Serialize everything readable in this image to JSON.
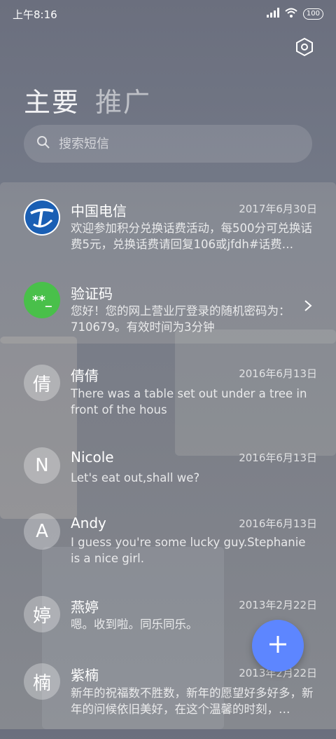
{
  "status_bar": {
    "time": "上午8:16",
    "battery": "100",
    "icons": [
      "signal-icon",
      "wifi-icon",
      "battery-icon"
    ]
  },
  "header": {
    "settings_icon": "gear-icon",
    "tabs": [
      {
        "label": "主要",
        "active": true
      },
      {
        "label": "推广",
        "active": false
      }
    ]
  },
  "search": {
    "placeholder": "搜索短信",
    "value": ""
  },
  "conversations": [
    {
      "avatar": "",
      "avatar_type": "telecom-logo",
      "name": "中国电信",
      "date": "2017年6月30日",
      "preview": "欢迎参加积分兑换话费活动，每500分可兑换话费5元，兑换话费请回复106或jfdh#话费…"
    },
    {
      "avatar": "**_",
      "avatar_type": "green",
      "name": "验证码",
      "date": "",
      "preview": "您好！您的网上营业厅登录的随机密码为：710679。有效时间为3分钟"
    },
    {
      "avatar": "倩",
      "avatar_type": "letter",
      "name": "倩倩",
      "date": "2016年6月13日",
      "preview": "There was a table set out under a tree in front of the hous"
    },
    {
      "avatar": "N",
      "avatar_type": "letter",
      "name": "Nicole",
      "date": "2016年6月13日",
      "preview": "Let's eat out,shall we?"
    },
    {
      "avatar": "A",
      "avatar_type": "letter",
      "name": "Andy",
      "date": "2016年6月13日",
      "preview": "I guess you're some lucky guy.Stephanie is a nice girl."
    },
    {
      "avatar": "婷",
      "avatar_type": "letter",
      "name": "燕婷",
      "date": "2013年2月22日",
      "preview": "嗯。收到啦。同乐同乐。"
    },
    {
      "avatar": "楠",
      "avatar_type": "letter",
      "name": "紫楠",
      "date": "2013年2月22日",
      "preview": "新年的祝福数不胜数，新年的愿望好多好多，新年的问候依旧美好，在这个温馨的时刻，…"
    }
  ],
  "fab": {
    "icon": "plus-icon"
  },
  "colors": {
    "fab": "#5d86ff",
    "verify_avatar": "#49c04a",
    "telecom_blue": "#1a5fb4"
  }
}
